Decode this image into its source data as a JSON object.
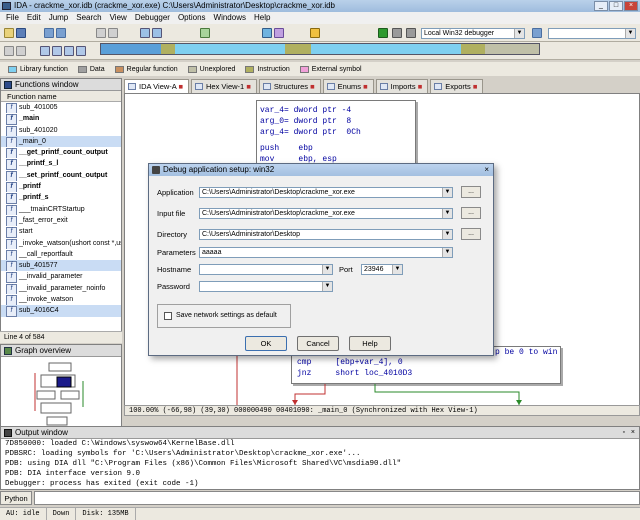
{
  "window": {
    "title": "IDA - crackme_xor.idb (crackme_xor.exe) C:\\Users\\Administrator\\Desktop\\crackme_xor.idb"
  },
  "menu": [
    "File",
    "Edit",
    "Jump",
    "Search",
    "View",
    "Debugger",
    "Options",
    "Windows",
    "Help"
  ],
  "toolbar": {
    "debugger_select": "Local Win32 debugger"
  },
  "legend": [
    {
      "label": "Library function",
      "color": "#7fd0f0"
    },
    {
      "label": "Data",
      "color": "#a0a0a0"
    },
    {
      "label": "Regular function",
      "color": "#c89060"
    },
    {
      "label": "Unexplored",
      "color": "#c0c0a8"
    },
    {
      "label": "Instruction",
      "color": "#b0b060"
    },
    {
      "label": "External symbol",
      "color": "#f0a0d8"
    }
  ],
  "functions": {
    "title": "Functions window",
    "column": "Function name",
    "items": [
      "sub_401005",
      "_main",
      "sub_401020",
      "_main_0",
      "__get_printf_count_output",
      "__printf_s_l",
      "__set_printf_count_output",
      "_printf",
      "_printf_s",
      "___tmainCRTStartup",
      "_fast_error_exit",
      "start",
      "_invoke_watson(ushort const *,ushort",
      "__call_reportfault",
      "sub_401577",
      "__invalid_parameter",
      "__invalid_parameter_noinfo",
      "__invoke_watson",
      "sub_4016C4"
    ],
    "line_count": "Line 4 of 584"
  },
  "graph_overview": {
    "title": "Graph overview"
  },
  "tabs": [
    {
      "label": "IDA View-A",
      "active": true
    },
    {
      "label": "Hex View-1"
    },
    {
      "label": "Structures"
    },
    {
      "label": "Enums"
    },
    {
      "label": "Imports"
    },
    {
      "label": "Exports"
    }
  ],
  "disasm": {
    "top": [
      "var_4= dword ptr -4",
      "arg_0= dword ptr  8",
      "arg_4= dword ptr  0Ch",
      "",
      "push    ebp",
      "mov     ebp, esp"
    ],
    "mid": [
      "cmp     [ebp+var_4], 0",
      "jnz     short loc_4010D3"
    ],
    "right_fragment": "p be 0 to win"
  },
  "statusline": "100.00% (-66,98) (39,30) 000000490 00401090: _main_0 (Synchronized with Hex View-1)",
  "output": {
    "title": "Output window",
    "lines": [
      "7D850000: loaded C:\\Windows\\syswow64\\KernelBase.dll",
      "PDBSRC: loading symbols for 'C:\\Users\\Administrator\\Desktop\\crackme_xor.exe'...",
      "PDB: using DIA dll \"C:\\Program Files (x86)\\Common Files\\Microsoft Shared\\VC\\msdia90.dll\"",
      "PDB: DIA interface version 9.0",
      "Debugger: process has exited (exit code -1)"
    ],
    "python_label": "Python"
  },
  "statusbar": {
    "au": "AU:  idle",
    "direction": "Down",
    "disk": "Disk: 135MB"
  },
  "dialog": {
    "title": "Debug application setup: win32",
    "application_label": "Application",
    "application_value": "C:\\Users\\Administrator\\Desktop\\crackme_xor.exe",
    "input_label": "Input file",
    "input_value": "C:\\Users\\Administrator\\Desktop\\crackme_xor.exe",
    "directory_label": "Directory",
    "directory_value": "C:\\Users\\Administrator\\Desktop",
    "parameters_label": "Parameters",
    "parameters_value": "aaaaa",
    "hostname_label": "Hostname",
    "hostname_value": "",
    "port_label": "Port",
    "port_value": "23946",
    "password_label": "Password",
    "password_value": "",
    "save_label": "Save network settings as default",
    "browse": "...",
    "ok": "OK",
    "cancel": "Cancel",
    "help": "Help"
  }
}
